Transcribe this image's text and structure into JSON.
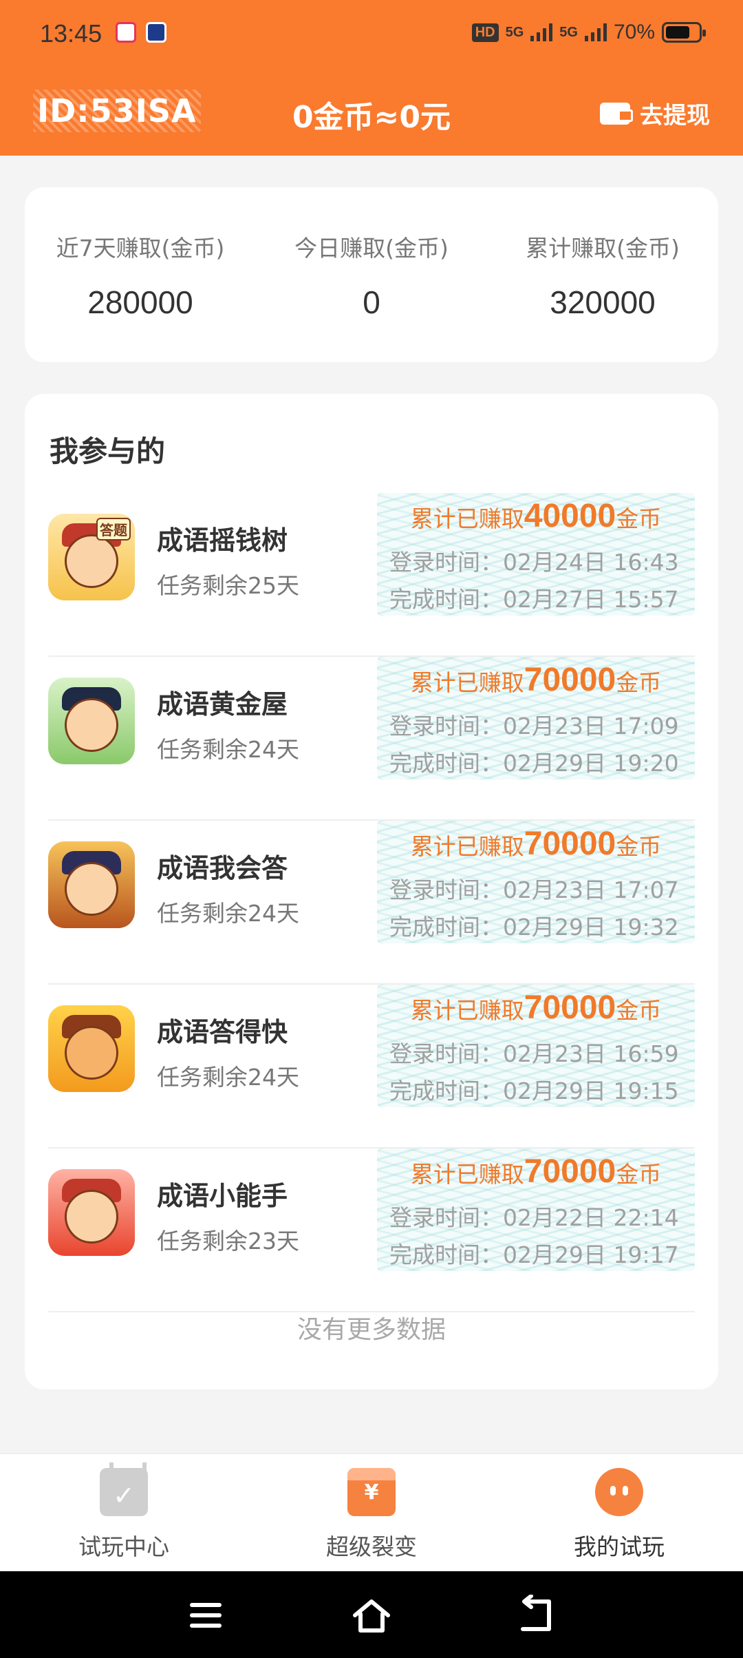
{
  "status_bar": {
    "time": "13:45",
    "network_1": "5G",
    "network_2": "5G",
    "battery": "70%"
  },
  "header": {
    "user_id": "ID:53ISA",
    "balance": "0金币≈0元",
    "withdraw_label": "去提现"
  },
  "stats": [
    {
      "label": "近7天赚取(金币)",
      "value": "280000"
    },
    {
      "label": "今日赚取(金币)",
      "value": "0"
    },
    {
      "label": "累计赚取(金币)",
      "value": "320000"
    }
  ],
  "participated": {
    "title": "我参与的",
    "earn_prefix": "累计已赚取",
    "earn_suffix": "金币",
    "login_prefix": "登录时间：",
    "done_prefix": "完成时间：",
    "items": [
      {
        "name": "成语摇钱树",
        "remain": "任务剩余25天",
        "amount": "40000",
        "login": "02月24日 16:43",
        "done": "02月27日 15:57",
        "icon": "caishen-icon",
        "tag": "答题"
      },
      {
        "name": "成语黄金屋",
        "remain": "任务剩余24天",
        "amount": "70000",
        "login": "02月23日 17:09",
        "done": "02月29日 19:20",
        "icon": "official-icon",
        "tag": ""
      },
      {
        "name": "成语我会答",
        "remain": "任务剩余24天",
        "amount": "70000",
        "login": "02月23日 17:07",
        "done": "02月29日 19:32",
        "icon": "scholar-icon",
        "tag": ""
      },
      {
        "name": "成语答得快",
        "remain": "任务剩余24天",
        "amount": "70000",
        "login": "02月23日 16:59",
        "done": "02月29日 19:15",
        "icon": "shiba-icon",
        "tag": ""
      },
      {
        "name": "成语小能手",
        "remain": "任务剩余23天",
        "amount": "70000",
        "login": "02月22日 22:14",
        "done": "02月29日 19:17",
        "icon": "red-hat-icon",
        "tag": ""
      }
    ],
    "no_more": "没有更多数据"
  },
  "bottom_nav": [
    {
      "label": "试玩中心",
      "icon": "calendar-check-icon",
      "active": false
    },
    {
      "label": "超级裂变",
      "icon": "red-packet-icon",
      "active": false
    },
    {
      "label": "我的试玩",
      "icon": "mascot-icon",
      "active": true
    }
  ],
  "colors": {
    "brand": "#fa7a2e",
    "earn_text": "#f07a2a",
    "background": "#f4f4f4"
  }
}
